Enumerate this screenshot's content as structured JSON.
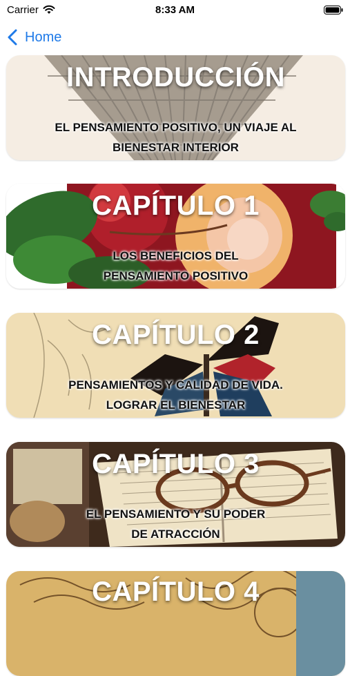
{
  "status_bar": {
    "carrier": "Carrier",
    "time": "8:33 AM",
    "icons": [
      "wifi-icon",
      "battery-icon"
    ]
  },
  "nav": {
    "back_label": "Home",
    "back_icon": "chevron-left-icon",
    "accent_color": "#1f7ae8"
  },
  "cards": [
    {
      "title": "INTRODUCCIÓN",
      "subtitle_line1": "EL PENSAMIENTO POSITIVO, UN VIAJE AL",
      "subtitle_line2": "BIENESTAR INTERIOR",
      "image": "vintage hot air balloon engraving"
    },
    {
      "title": "CAPÍTULO 1",
      "subtitle_line1": "LOS BENEFICIOS DEL",
      "subtitle_line2": "PENSAMIENTO POSITIVO",
      "image": "vintage roses and leaves"
    },
    {
      "title": "CAPÍTULO 2",
      "subtitle_line1": "PENSAMIENTOS Y CALIDAD DE VIDA.",
      "subtitle_line2": "LOGRAR EL BIENESTAR",
      "image": "butterfly on vintage parchment"
    },
    {
      "title": "CAPÍTULO 3",
      "subtitle_line1": "EL PENSAMIENTO Y SU PODER",
      "subtitle_line2": "DE ATRACCIÓN",
      "image": "reading glasses on old book"
    },
    {
      "title": "CAPÍTULO 4",
      "subtitle_line1": "",
      "subtitle_line2": "",
      "image": "vintage engraving"
    }
  ]
}
